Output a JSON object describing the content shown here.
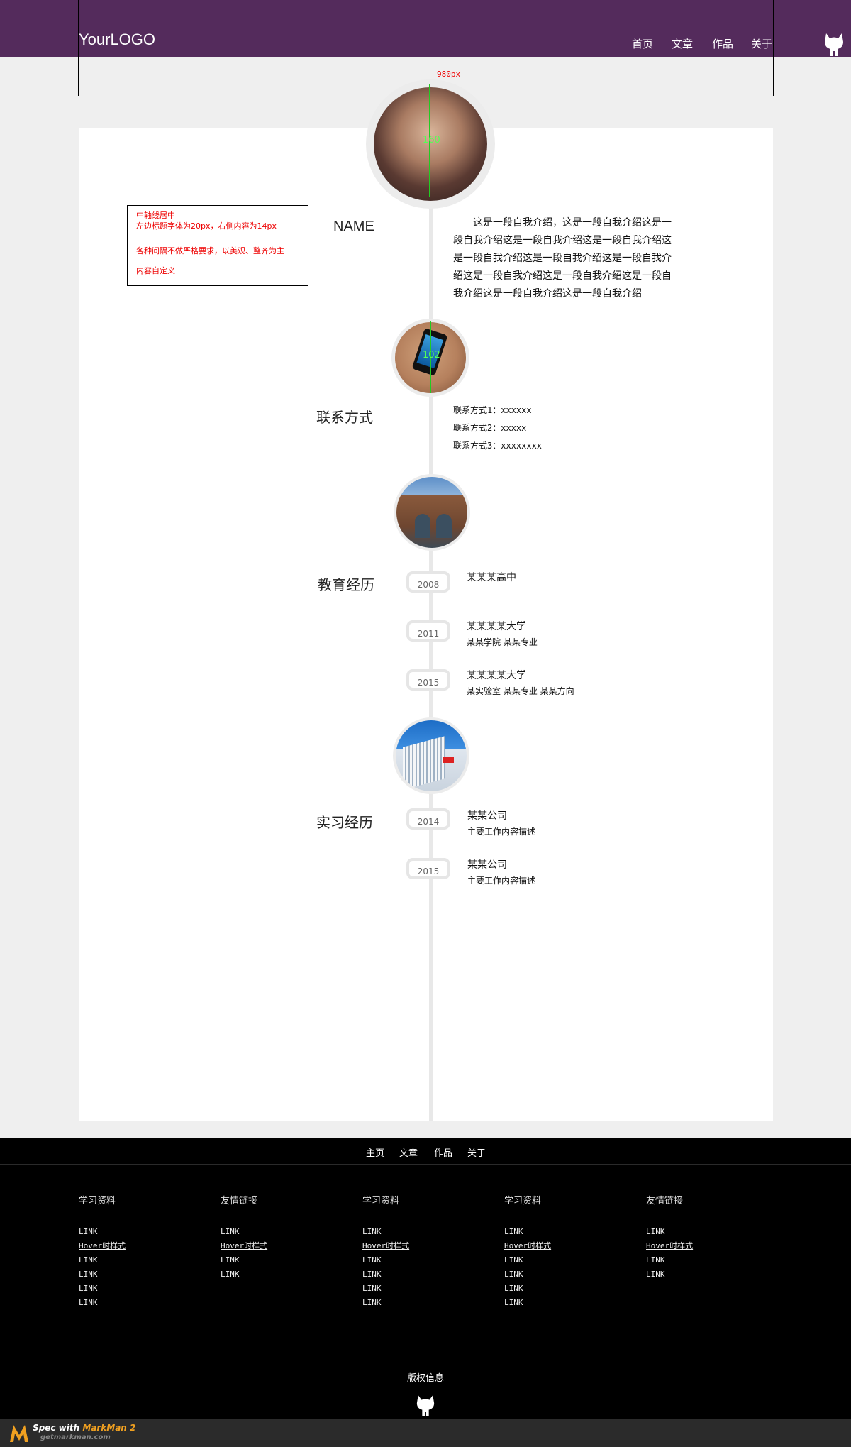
{
  "header": {
    "logo": "YourLOGO",
    "nav": [
      "首页",
      "文章",
      "作品",
      "关于"
    ]
  },
  "spec": {
    "width_label": "980px",
    "avatar_label": "160",
    "phone_label": "102"
  },
  "note": {
    "lines": [
      "中轴线居中",
      "左边标题字体为20px，右侧内容为14px",
      "各种间隔不做严格要求，以美观、整齐为主",
      "内容自定义"
    ]
  },
  "profile": {
    "title": "NAME",
    "intro": "这是一段自我介绍，这是一段自我介绍这是一段自我介绍这是一段自我介绍这是一段自我介绍这是一段自我介绍这是一段自我介绍这是一段自我介绍这是一段自我介绍这是一段自我介绍这是一段自我介绍这是一段自我介绍这是一段自我介绍"
  },
  "contact": {
    "title": "联系方式",
    "items": [
      "联系方式1：xxxxxx",
      "联系方式2：xxxxx",
      "联系方式3：xxxxxxxx"
    ]
  },
  "education": {
    "title": "教育经历",
    "items": [
      {
        "year": "2008",
        "name": "某某某高中",
        "detail": ""
      },
      {
        "year": "2011",
        "name": "某某某某大学",
        "detail": "某某学院 某某专业"
      },
      {
        "year": "2015",
        "name": "某某某某大学",
        "detail": "某实验室 某某专业 某某方向"
      }
    ]
  },
  "internship": {
    "title": "实习经历",
    "items": [
      {
        "year": "2014",
        "name": "某某公司",
        "detail": "主要工作内容描述"
      },
      {
        "year": "2015",
        "name": "某某公司",
        "detail": "主要工作内容描述"
      }
    ]
  },
  "footer_nav": [
    "主页",
    "文章",
    "作品",
    "关于"
  ],
  "footer_cols": [
    {
      "title": "学习资料",
      "links": [
        "LINK",
        "Hover时样式",
        "LINK",
        "LINK",
        "LINK",
        "LINK"
      ]
    },
    {
      "title": "友情链接",
      "links": [
        "LINK",
        "Hover时样式",
        "LINK",
        "LINK"
      ]
    },
    {
      "title": "学习资料",
      "links": [
        "LINK",
        "Hover时样式",
        "LINK",
        "LINK",
        "LINK",
        "LINK"
      ]
    },
    {
      "title": "学习资料",
      "links": [
        "LINK",
        "Hover时样式",
        "LINK",
        "LINK",
        "LINK",
        "LINK"
      ]
    },
    {
      "title": "友情链接",
      "links": [
        "LINK",
        "Hover时样式",
        "LINK",
        "LINK"
      ]
    }
  ],
  "copyright": "版权信息",
  "markman": {
    "prefix": "Spec with ",
    "brand": "MarkMan 2",
    "site": "getmarkman.com"
  },
  "icons": {
    "github": "github-cat-icon"
  }
}
